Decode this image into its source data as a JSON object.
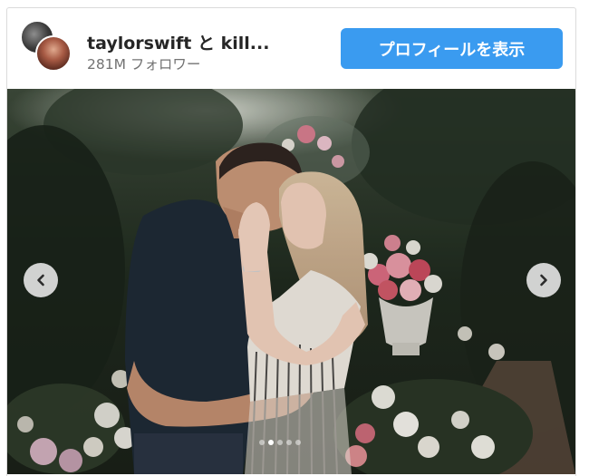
{
  "post": {
    "username": "taylorswift と kill...",
    "followers": "281M フォロワー",
    "profile_button_label": "プロフィールを表示",
    "photo_alt": "",
    "carousel": {
      "slide_count": 5,
      "active_index": 1
    }
  },
  "colors": {
    "button_bg": "#3a9bf0",
    "username_text": "#262626",
    "secondary_text": "#737373"
  },
  "icons": {
    "prev": "chevron-left-icon",
    "next": "chevron-right-icon"
  }
}
